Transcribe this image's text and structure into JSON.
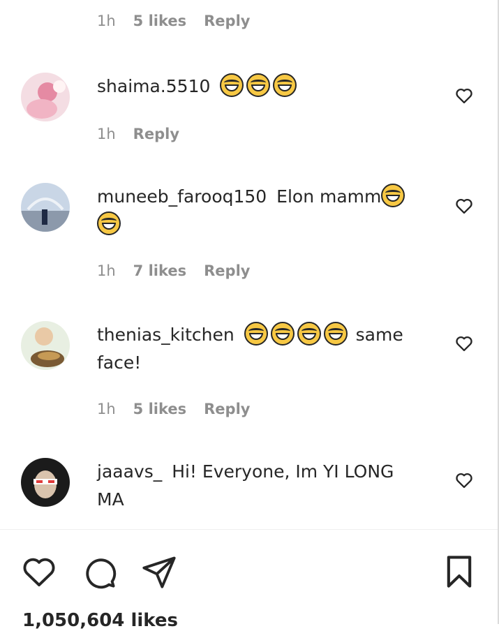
{
  "top_meta": {
    "time": "1h",
    "likes": "5 likes",
    "reply": "Reply"
  },
  "comments": [
    {
      "username": "shaima.5510",
      "text": "",
      "emoji_count": 3,
      "time": "1h",
      "likes": "",
      "reply": "Reply"
    },
    {
      "username": "muneeb_farooq150",
      "text": "Elon mamm",
      "emoji_count": 2,
      "time": "1h",
      "likes": "7 likes",
      "reply": "Reply"
    },
    {
      "username": "thenias_kitchen",
      "text": "same face!",
      "emoji_count": 4,
      "time": "1h",
      "likes": "5 likes",
      "reply": "Reply"
    },
    {
      "username": "jaaavs_",
      "text": "Hi! Everyone, Im YI LONG MA",
      "emoji_count": 0,
      "time": "",
      "likes": "",
      "reply": ""
    }
  ],
  "post_likes": "1,050,604 likes",
  "icons": {
    "like": "heart-icon",
    "comment": "comment-icon",
    "share": "send-icon",
    "save": "bookmark-icon"
  },
  "colors": {
    "text": "#262626",
    "meta": "#8e8e8e",
    "emoji": "#f7c844"
  }
}
